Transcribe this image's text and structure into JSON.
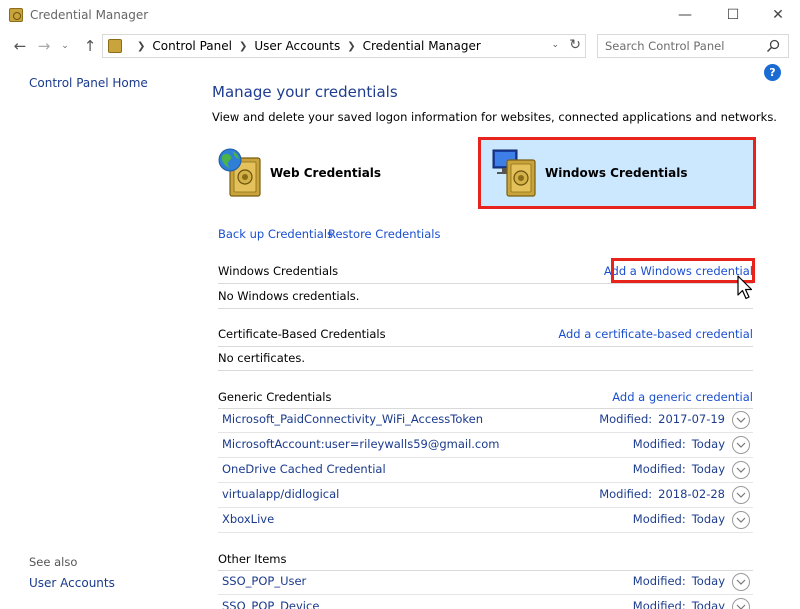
{
  "window": {
    "title": "Credential Manager",
    "min_glyph": "—",
    "max_glyph": "☐",
    "close_glyph": "✕"
  },
  "nav": {
    "back_glyph": "←",
    "forward_glyph": "→",
    "recent_glyph": "⌄",
    "up_glyph": "↑",
    "breadcrumbs": [
      "Control Panel",
      "User Accounts",
      "Credential Manager"
    ],
    "refresh_glyph": "↻",
    "dropdown_glyph": "⌄"
  },
  "search": {
    "placeholder": "Search Control Panel"
  },
  "help": {
    "glyph": "?"
  },
  "left_pane": {
    "home": "Control Panel Home",
    "see_also": "See also",
    "user_accounts": "User Accounts"
  },
  "main": {
    "title": "Manage your credentials",
    "description": "View and delete your saved logon information for websites, connected applications and networks.",
    "tiles": {
      "web": "Web Credentials",
      "windows": "Windows Credentials"
    },
    "backup": "Back up Credentials",
    "restore": "Restore Credentials"
  },
  "sections": {
    "windows": {
      "heading": "Windows Credentials",
      "add": "Add a Windows credential",
      "empty": "No Windows credentials."
    },
    "certificate": {
      "heading": "Certificate-Based Credentials",
      "add": "Add a certificate-based credential",
      "empty": "No certificates."
    },
    "generic": {
      "heading": "Generic Credentials",
      "add": "Add a generic credential",
      "items": [
        {
          "name": "Microsoft_PaidConnectivity_WiFi_AccessToken",
          "modified_label": "Modified:",
          "modified": "2017-07-19"
        },
        {
          "name": "MicrosoftAccount:user=rileywalls59@gmail.com",
          "modified_label": "Modified:",
          "modified": "Today"
        },
        {
          "name": "OneDrive Cached Credential",
          "modified_label": "Modified:",
          "modified": "Today"
        },
        {
          "name": "virtualapp/didlogical",
          "modified_label": "Modified:",
          "modified": "2018-02-28"
        },
        {
          "name": "XboxLive",
          "modified_label": "Modified:",
          "modified": "Today"
        }
      ]
    },
    "other": {
      "heading": "Other Items",
      "items": [
        {
          "name": "SSO_POP_User",
          "modified_label": "Modified:",
          "modified": "Today"
        },
        {
          "name": "SSO_POP_Device",
          "modified_label": "Modified:",
          "modified": "Today"
        }
      ]
    }
  },
  "colors": {
    "highlight": "#e8231c",
    "selected_tile": "#cce8ff",
    "link": "#1a4fcf",
    "title": "#1e3d8f"
  }
}
